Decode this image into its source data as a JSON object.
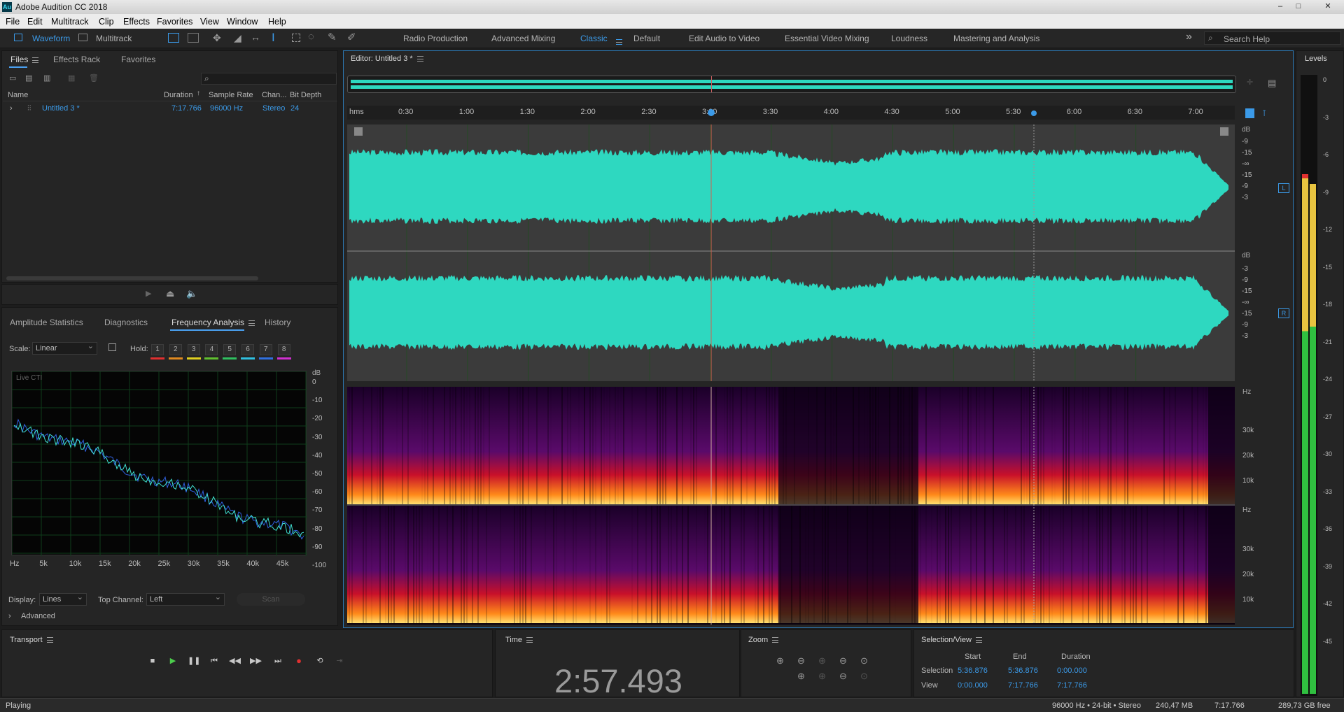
{
  "app": {
    "title": "Adobe Audition CC 2018",
    "logo": "Au"
  },
  "window_controls": {
    "minimize": "–",
    "maximize": "□",
    "close": "✕"
  },
  "menu": [
    "File",
    "Edit",
    "Multitrack",
    "Clip",
    "Effects",
    "Favorites",
    "View",
    "Window",
    "Help"
  ],
  "toolbar": {
    "waveform": "Waveform",
    "multitrack": "Multitrack",
    "workspaces": [
      "Radio Production",
      "Advanced Mixing",
      "Classic",
      "Default",
      "Edit Audio to Video",
      "Essential Video Mixing",
      "Loudness",
      "Mastering and Analysis"
    ],
    "active_workspace": "Classic",
    "overflow": "»",
    "search_placeholder": "Search Help"
  },
  "files_panel": {
    "tabs": [
      "Files",
      "Effects Rack",
      "Favorites"
    ],
    "search_icon": "⌕",
    "columns": {
      "name": "Name",
      "duration": "Duration",
      "sample_rate": "Sample Rate",
      "channels": "Chan...",
      "bit_depth": "Bit Depth"
    },
    "row": {
      "name": "Untitled 3 *",
      "duration": "7:17.766",
      "sample_rate": "96000 Hz",
      "channels": "Stereo",
      "bit_depth": "24"
    }
  },
  "analysis_panel": {
    "tabs": [
      "Amplitude Statistics",
      "Diagnostics",
      "Frequency Analysis",
      "History"
    ],
    "active_tab": "Frequency Analysis",
    "scale_label": "Scale:",
    "scale_value": "Linear",
    "hold_label": "Hold:",
    "hold_buttons": [
      "1",
      "2",
      "3",
      "4",
      "5",
      "6",
      "7",
      "8"
    ],
    "hold_colors": [
      "#e03030",
      "#e08a20",
      "#e0d020",
      "#60c030",
      "#30c060",
      "#30c0e0",
      "#3070e0",
      "#d030d0"
    ],
    "live_label": "Live CTI",
    "db_unit": "dB",
    "db_ticks": [
      "0",
      "-10",
      "-20",
      "-30",
      "-40",
      "-50",
      "-60",
      "-70",
      "-80",
      "-90",
      "-100"
    ],
    "x_ticks": [
      "Hz",
      "5k",
      "10k",
      "15k",
      "20k",
      "25k",
      "30k",
      "35k",
      "40k",
      "45k"
    ],
    "display_label": "Display:",
    "display_value": "Lines",
    "top_channel_label": "Top Channel:",
    "top_channel_value": "Left",
    "scan_label": "Scan",
    "advanced_label": "Advanced"
  },
  "editor": {
    "title": "Editor: Untitled 3 *",
    "ruler_unit": "hms",
    "ruler_ticks": [
      "0:30",
      "1:00",
      "1:30",
      "2:00",
      "2:30",
      "3:00",
      "3:30",
      "4:00",
      "4:30",
      "5:00",
      "5:30",
      "6:00",
      "6:30",
      "7:00"
    ],
    "db_unit": "dB",
    "db_scale": [
      "-9",
      "-15",
      "-∞",
      "-15",
      "-9",
      "-3"
    ],
    "db_scale_right": [
      "-3",
      "-9",
      "-15",
      "-∞",
      "-15",
      "-9",
      "-3"
    ],
    "channel_left": "L",
    "channel_right": "R",
    "hz_unit": "Hz",
    "spec_ticks": [
      "30k",
      "20k",
      "10k"
    ],
    "waveform_color": "#2ed8c0"
  },
  "levels_panel": {
    "title": "Levels",
    "ticks": [
      "0",
      "-3",
      "-6",
      "-9",
      "-12",
      "-15",
      "-18",
      "-21",
      "-24",
      "-27",
      "-30",
      "-33",
      "-36",
      "-39",
      "-42",
      "-45"
    ]
  },
  "transport": {
    "title": "Transport",
    "status": "Playing"
  },
  "time_panel": {
    "title": "Time",
    "value": "2:57.493"
  },
  "zoom_panel": {
    "title": "Zoom"
  },
  "selection_panel": {
    "title": "Selection/View",
    "headers": [
      "Start",
      "End",
      "Duration"
    ],
    "selection_label": "Selection",
    "selection": [
      "5:36.876",
      "5:36.876",
      "0:00.000"
    ],
    "view_label": "View",
    "view": [
      "0:00.000",
      "7:17.766",
      "7:17.766"
    ]
  },
  "status_bar": {
    "status": "Playing",
    "format": "96000 Hz • 24-bit • Stereo",
    "size": "240,47 MB",
    "duration": "7:17.766",
    "free": "289,73 GB free"
  }
}
